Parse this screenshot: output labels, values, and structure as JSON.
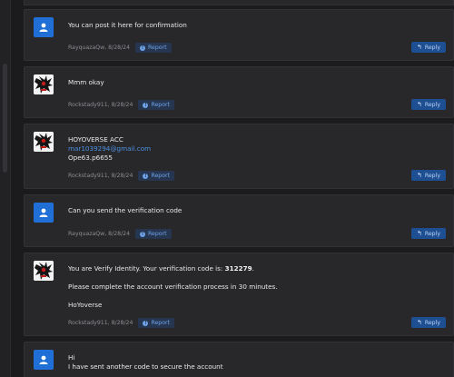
{
  "posts": [
    {
      "avatar": "default-user-icon",
      "lines": [
        "You can post it here for confirmation"
      ],
      "author": "RayquazaQw",
      "date": "8/28/24",
      "report_label": "Report",
      "reply_label": "Reply"
    },
    {
      "avatar": "custom-avatar",
      "lines": [
        "Mmm okay"
      ],
      "author": "Rockstady911",
      "date": "8/28/24",
      "report_label": "Report",
      "reply_label": "Reply"
    },
    {
      "avatar": "custom-avatar",
      "lines": [
        "HOYOVERSE ACC",
        "mar1039294@gmail.com",
        "Ope63.p6655"
      ],
      "author": "Rockstady911",
      "date": "8/28/24",
      "report_label": "Report",
      "reply_label": "Reply"
    },
    {
      "avatar": "default-user-icon",
      "lines": [
        "Can you send the verification code"
      ],
      "author": "RayquazaQw",
      "date": "8/28/24",
      "report_label": "Report",
      "reply_label": "Reply"
    },
    {
      "avatar": "custom-avatar",
      "lines": [
        "You are Verify Identity. Your verification code is: ",
        "312279",
        ".",
        "Please complete the account verification process in 30 minutes.",
        "HoYoverse"
      ],
      "author": "Rockstady911",
      "date": "8/28/24",
      "report_label": "Report",
      "reply_label": "Reply"
    },
    {
      "avatar": "default-user-icon",
      "lines": [
        "Hi",
        "I have sent another code to secure the account"
      ]
    }
  ],
  "colors": {
    "accent": "#1f6fd6",
    "reply_button": "#1f4f93",
    "report_button": "#263651",
    "post_bg": "#28282b",
    "page_bg": "#1b1b1d"
  }
}
